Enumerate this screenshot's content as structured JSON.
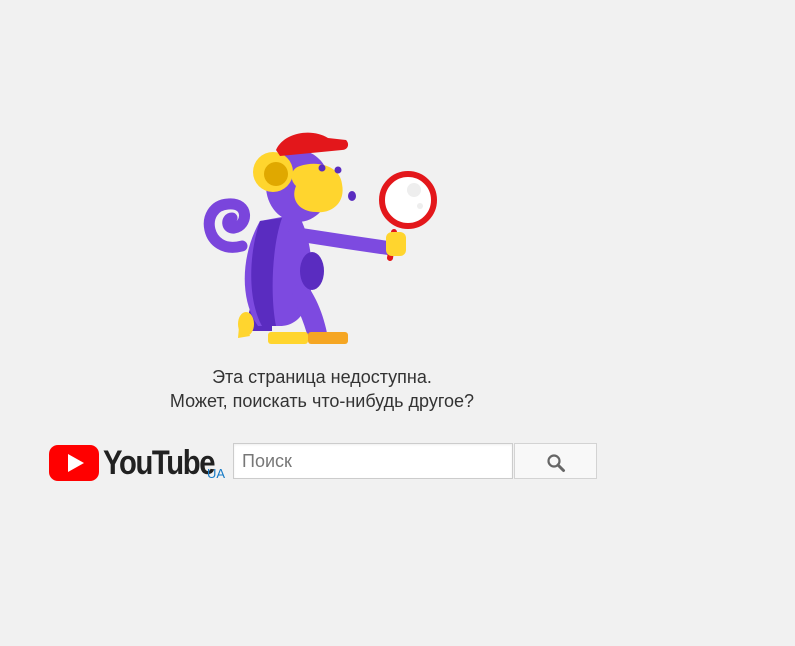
{
  "error": {
    "line1": "Эта страница недоступна.",
    "line2": "Может, поискать что-нибудь другое?"
  },
  "logo": {
    "wordmark": "YouTube",
    "country_code": "UA",
    "brand_color": "#ff0000"
  },
  "search": {
    "placeholder": "Поиск",
    "button_icon": "search-icon"
  },
  "illustration": {
    "name": "monkey-with-magnifying-glass",
    "body_color": "#6f3bd6",
    "face_color": "#ffd52e",
    "cap_color": "#e3171b"
  }
}
